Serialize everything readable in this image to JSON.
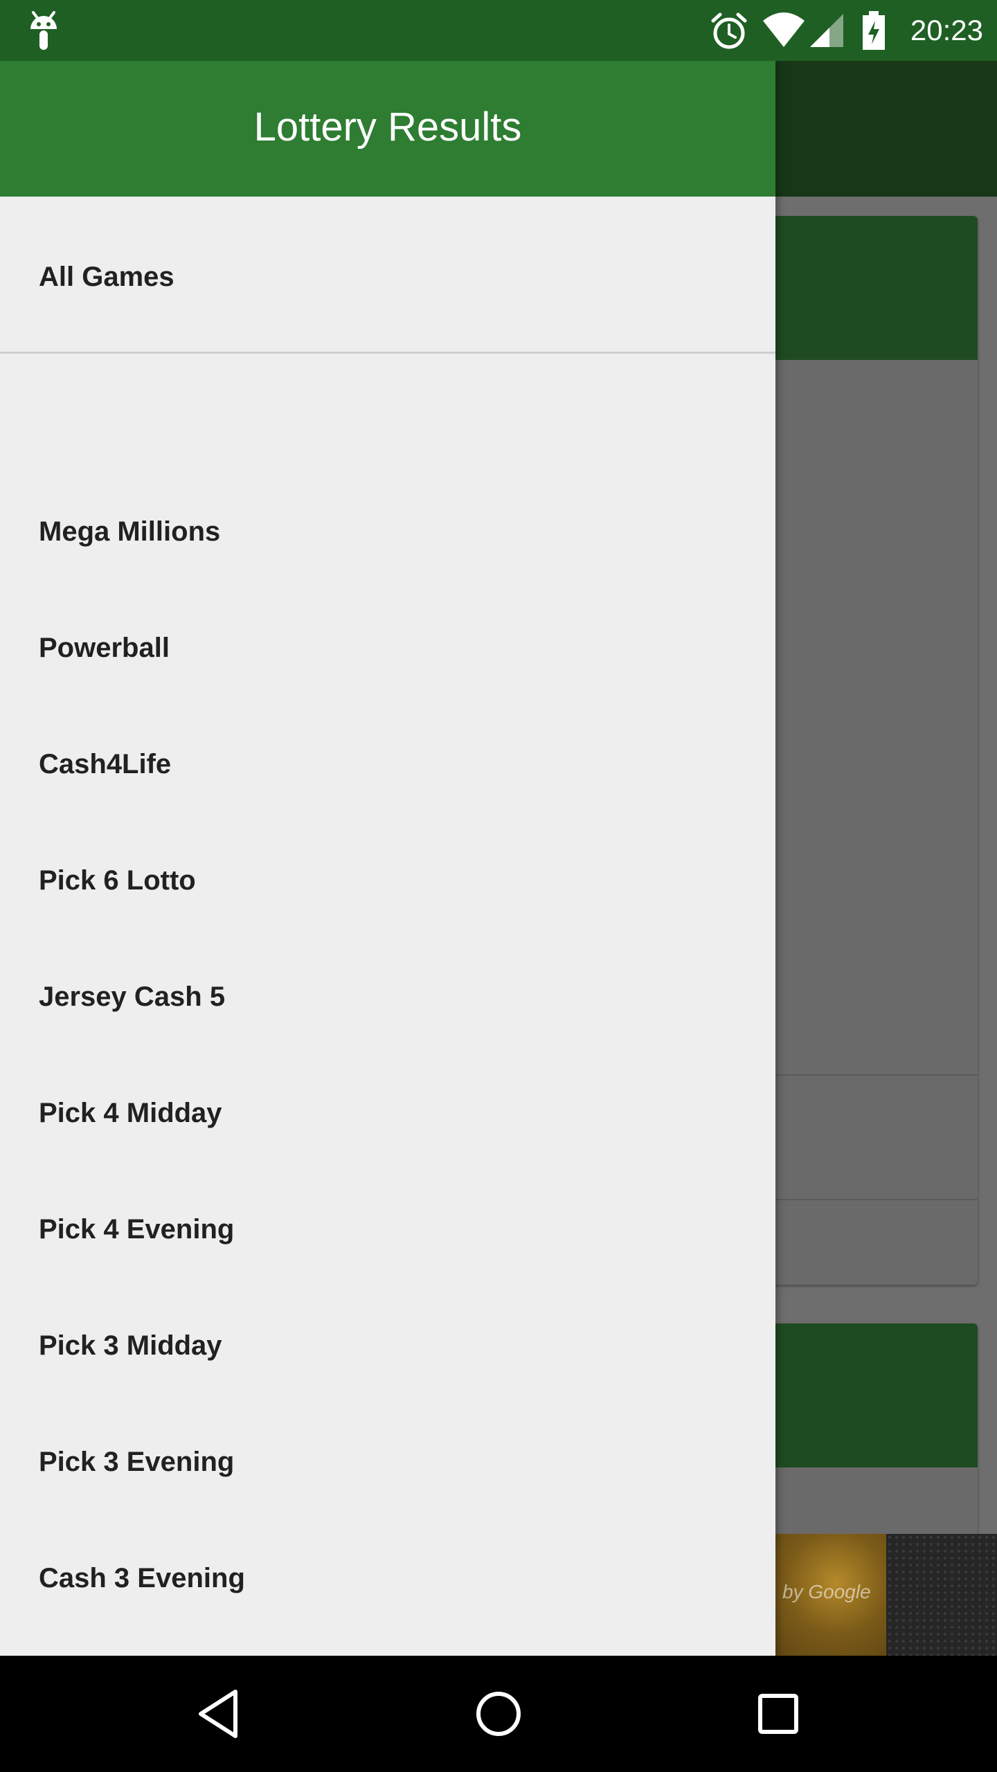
{
  "status_bar": {
    "time": "20:23",
    "icons": [
      "android-debug-icon",
      "alarm-icon",
      "wifi-icon",
      "cell-signal-icon",
      "battery-charging-icon"
    ]
  },
  "drawer": {
    "title": "Lottery Results",
    "all_games_label": "All Games",
    "items": [
      {
        "label": "Mega Millions"
      },
      {
        "label": "Powerball"
      },
      {
        "label": "Cash4Life"
      },
      {
        "label": "Pick 6 Lotto"
      },
      {
        "label": "Jersey Cash 5"
      },
      {
        "label": "Pick 4 Midday"
      },
      {
        "label": "Pick 4 Evening"
      },
      {
        "label": "Pick 3 Midday"
      },
      {
        "label": "Pick 3 Evening"
      },
      {
        "label": "Cash 3 Evening"
      }
    ]
  },
  "ad": {
    "text": "by Google"
  },
  "nav_bar": {
    "buttons": [
      "back-icon",
      "home-icon",
      "recents-icon"
    ]
  },
  "colors": {
    "status_bar": "#1f5f24",
    "drawer_header": "#2e7d32",
    "drawer_background": "#eeeeee",
    "item_text": "#212121"
  }
}
